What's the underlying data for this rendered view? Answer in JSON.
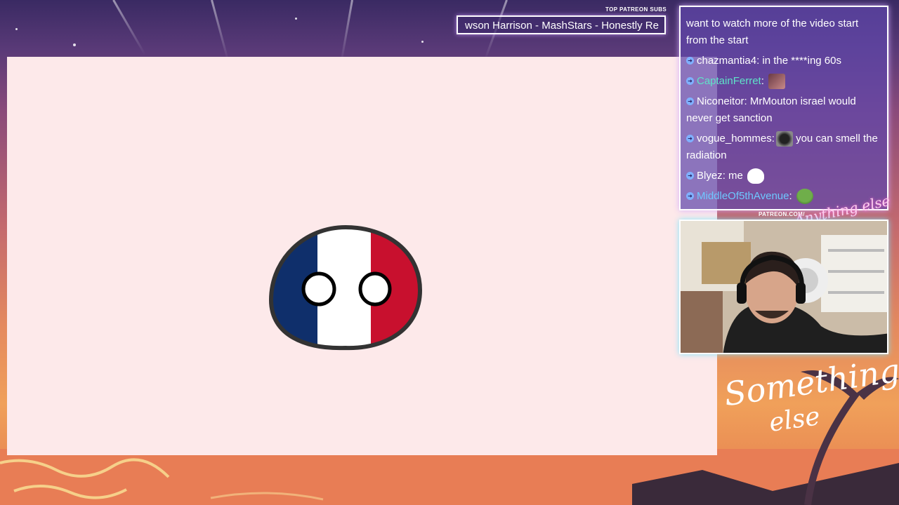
{
  "ticker": {
    "label": "TOP PATREON SUBS",
    "text": "wson Harrison - MashStars - Honestly Re"
  },
  "chat": {
    "messages": [
      {
        "user": "",
        "text": "g_gumpeu...  want to watch more of the video start from the start",
        "visible_text": "want to watch more of the video start from the start",
        "user_color": "#ffffff"
      },
      {
        "user": "chazmantia4",
        "text": "in the ****ing 60s",
        "user_color": "#ffffff",
        "emote": null
      },
      {
        "user": "CaptainFerret",
        "text": "",
        "user_color": "#5fe3c8",
        "emote": "ferret-emote"
      },
      {
        "user": "Niconeitor",
        "text": "MrMouton israel would never get sanction",
        "user_color": "#ffffff",
        "emote": null
      },
      {
        "user": "vogue_hommes",
        "text": "you can smell the radiation",
        "user_color": "#ffffff",
        "emote": "skull-emote"
      },
      {
        "user": "Blyez",
        "text": "me",
        "user_color": "#ffffff",
        "emote": "ghost-emote"
      },
      {
        "user": "MiddleOf5thAvenue",
        "text": "",
        "user_color": "#6ec8ff",
        "emote": "frog-emote"
      }
    ],
    "partial_top_text": "want to watch more of the video start from the start"
  },
  "webcam": {
    "label": "PATREON.COM/",
    "logo_text": "Anything else"
  },
  "overlay": {
    "brand_script_line1": "Something",
    "brand_script_line2": "else"
  },
  "colors": {
    "video_bg": "#fde9ea",
    "flag_blue": "#0f2f6b",
    "flag_white": "#ffffff",
    "flag_red": "#c8102e",
    "chat_bg": "#5f46aa"
  }
}
